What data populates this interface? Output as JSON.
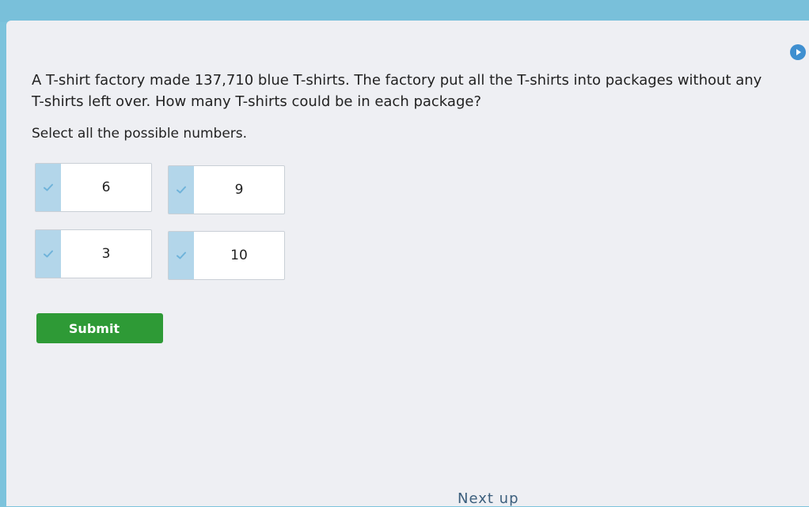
{
  "question": {
    "text": "A T-shirt factory made 137,710 blue T-shirts. The factory put all the T-shirts into packages without any T-shirts left over. How many T-shirts could be in each package?",
    "instruction": "Select all the possible numbers."
  },
  "choices": [
    {
      "label": "6",
      "selected": false
    },
    {
      "label": "9",
      "selected": false
    },
    {
      "label": "3",
      "selected": false
    },
    {
      "label": "10",
      "selected": false
    }
  ],
  "submit_label": "Submit",
  "next_up_label": "Next up",
  "icons": {
    "audio": "play-audio-icon",
    "choice_check": "checkmark-icon"
  },
  "colors": {
    "top_bar": "#79c0da",
    "panel": "#eeeff3",
    "check_zone": "#b3d6ea",
    "submit": "#2e9a36",
    "audio_button": "#3f8fd0"
  }
}
